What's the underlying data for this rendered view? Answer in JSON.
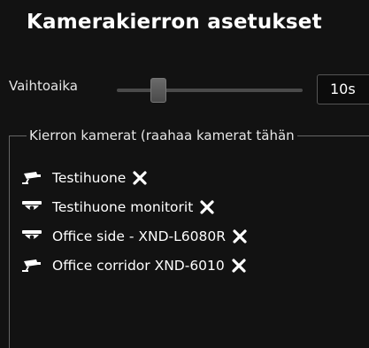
{
  "title": "Kamerakierron asetukset",
  "interval": {
    "label": "Vaihtoaika",
    "value": "10s",
    "slider_level": 0.2
  },
  "rotation": {
    "legend": "Kierron kamerat (raahaa kamerat tähän",
    "cameras": [
      {
        "name": "Testihuone",
        "icon": "bullet-camera-icon"
      },
      {
        "name": "Testihuone monitorit",
        "icon": "dome-camera-icon"
      },
      {
        "name": "Office side - XND-L6080R",
        "icon": "dome-camera-icon"
      },
      {
        "name": "Office corridor XND-6010",
        "icon": "bullet-camera-icon"
      }
    ],
    "remove_icon": "close-icon"
  },
  "colors": {
    "background": "#121212",
    "text": "#ffffff",
    "border": "#666666"
  }
}
